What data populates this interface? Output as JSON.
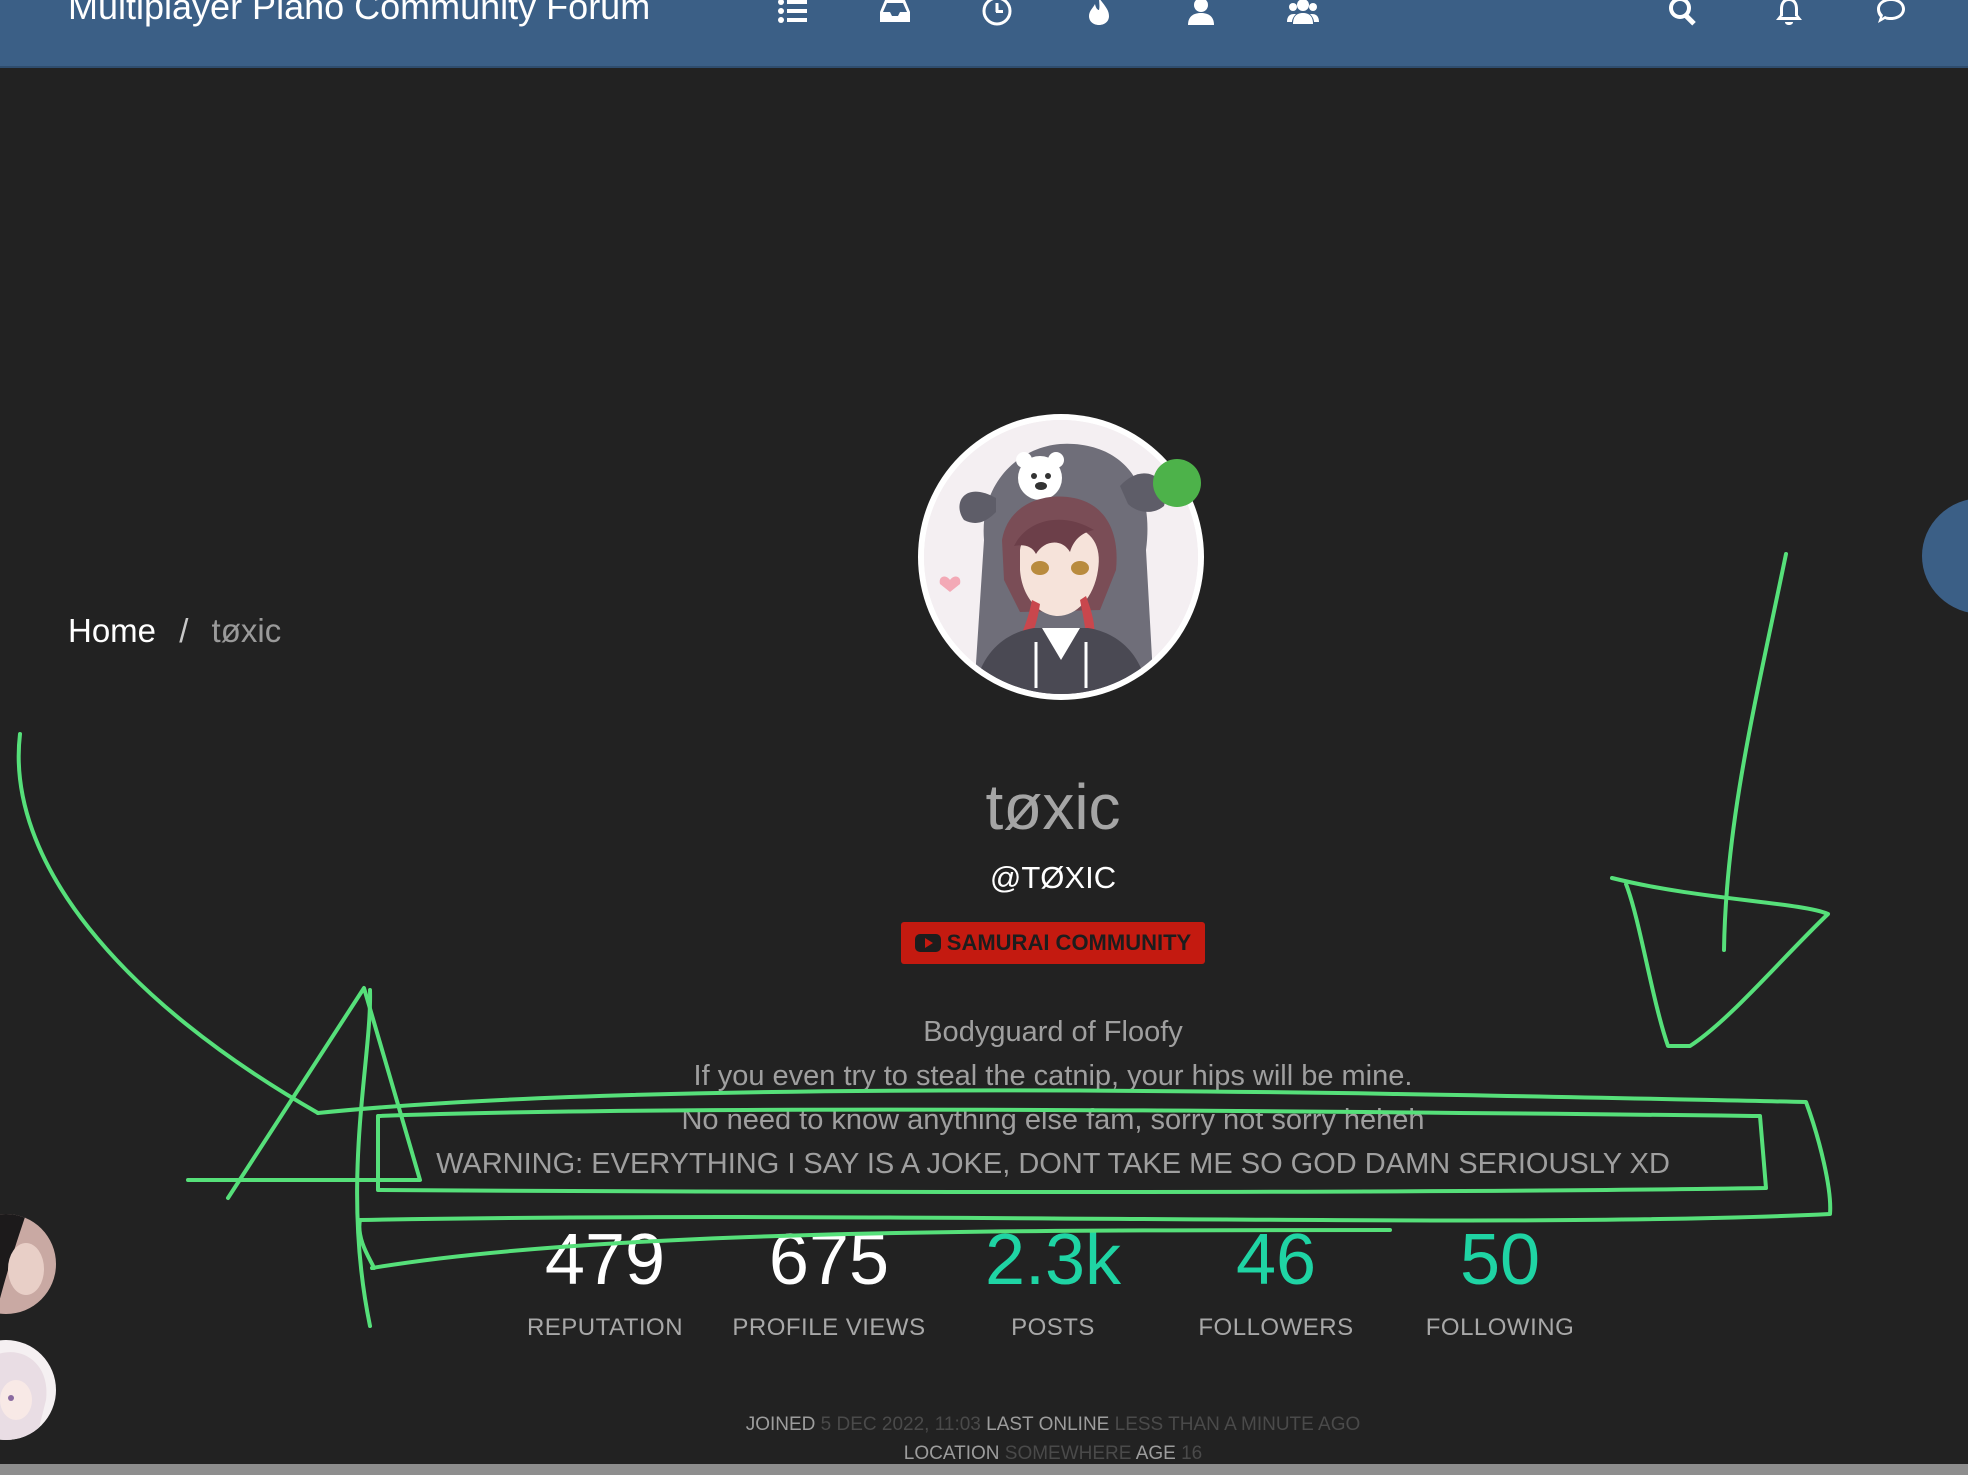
{
  "header": {
    "title": "Multiplayer Piano Community Forum",
    "nav_icons": [
      "list-icon",
      "inbox-icon",
      "clock-icon",
      "fire-icon",
      "user-icon",
      "users-icon"
    ],
    "right_icons": [
      "search-icon",
      "bell-icon",
      "chat-icon"
    ]
  },
  "breadcrumb": {
    "home": "Home",
    "separator": "/",
    "current": "tøxic"
  },
  "profile": {
    "display_name": "tøxic",
    "handle": "@TØXIC",
    "group_badge": "SAMURAI COMMUNITY",
    "bio": [
      "Bodyguard of Floofy",
      "If you even try to steal the catnip, your hips will be mine.",
      "No need to know anything else fam, sorry not sorry heheh",
      "WARNING: EVERYTHING I SAY IS A JOKE, DONT TAKE ME SO GOD DAMN SERIOUSLY XD"
    ]
  },
  "stats": [
    {
      "value": "479",
      "label": "REPUTATION"
    },
    {
      "value": "675",
      "label": "PROFILE VIEWS"
    },
    {
      "value": "2.3k",
      "label": "POSTS"
    },
    {
      "value": "46",
      "label": "FOLLOWERS"
    },
    {
      "value": "50",
      "label": "FOLLOWING"
    }
  ],
  "meta": {
    "joined_label": "JOINED",
    "joined_value": "5 DEC 2022, 11:03",
    "last_online_label": "LAST ONLINE",
    "last_online_value": "LESS THAN A MINUTE AGO",
    "location_label": "LOCATION",
    "location_value": "SOMEWHERE",
    "age_label": "AGE",
    "age_value": "16"
  },
  "colors": {
    "background": "#222222",
    "header": "#3b5f86",
    "accent": "#1fd4a4",
    "online": "#4db24a",
    "badge": "#c41a10",
    "annotation": "#56e07a"
  }
}
